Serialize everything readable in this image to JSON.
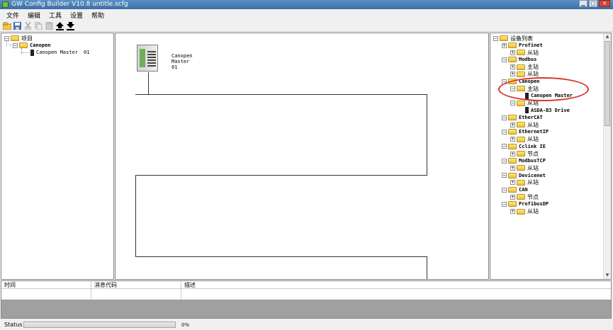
{
  "window": {
    "title": "GW Config Builder V10.8   untitle.scfg"
  },
  "menu": [
    "文件",
    "编辑",
    "工具",
    "设置",
    "帮助"
  ],
  "toolbar": {
    "icons": [
      "new-folder-icon",
      "save-icon",
      "cut-icon",
      "copy-icon",
      "paste-icon",
      "upload-icon",
      "download-icon"
    ]
  },
  "project_tree": {
    "root": "项目",
    "bus": "Canopen",
    "master": "Canopen Master",
    "master_addr": "01"
  },
  "canvas": {
    "device_label_line1": "Canopen",
    "device_label_line2": "Master",
    "device_label_line3": "01"
  },
  "device_list": {
    "root": "设备列表",
    "items": [
      {
        "label": "Profinet",
        "mono": true
      },
      {
        "label": "从站",
        "mono": false
      },
      {
        "label": "Modbus",
        "mono": true
      },
      {
        "label": "主站",
        "mono": false
      },
      {
        "label": "从站",
        "mono": false
      },
      {
        "label": "Canopen",
        "mono": true
      },
      {
        "label": "主站",
        "mono": false
      },
      {
        "label": "Canopen Master",
        "mono": true
      },
      {
        "label": "从站",
        "mono": false
      },
      {
        "label": "ASDA-B3 Drive",
        "mono": true
      },
      {
        "label": "EtherCAT",
        "mono": true
      },
      {
        "label": "从站",
        "mono": false
      },
      {
        "label": "EthernetIP",
        "mono": true
      },
      {
        "label": "从站",
        "mono": false
      },
      {
        "label": "Cclink IE",
        "mono": true
      },
      {
        "label": "节点",
        "mono": false
      },
      {
        "label": "ModbusTCP",
        "mono": true
      },
      {
        "label": "从站",
        "mono": false
      },
      {
        "label": "Devicenet",
        "mono": true
      },
      {
        "label": "从站",
        "mono": false
      },
      {
        "label": "CAN",
        "mono": true
      },
      {
        "label": "节点",
        "mono": false
      },
      {
        "label": "ProfibusDP",
        "mono": true
      },
      {
        "label": "从站",
        "mono": false
      }
    ]
  },
  "messages": {
    "col_time": "时间",
    "col_code": "消息代码",
    "col_desc": "描述"
  },
  "status": {
    "label": "Status",
    "progress_percent": 0,
    "progress_text": "0%"
  },
  "colors": {
    "highlight_circle": "#d9342b",
    "title_bar": "#3d6fa6"
  }
}
